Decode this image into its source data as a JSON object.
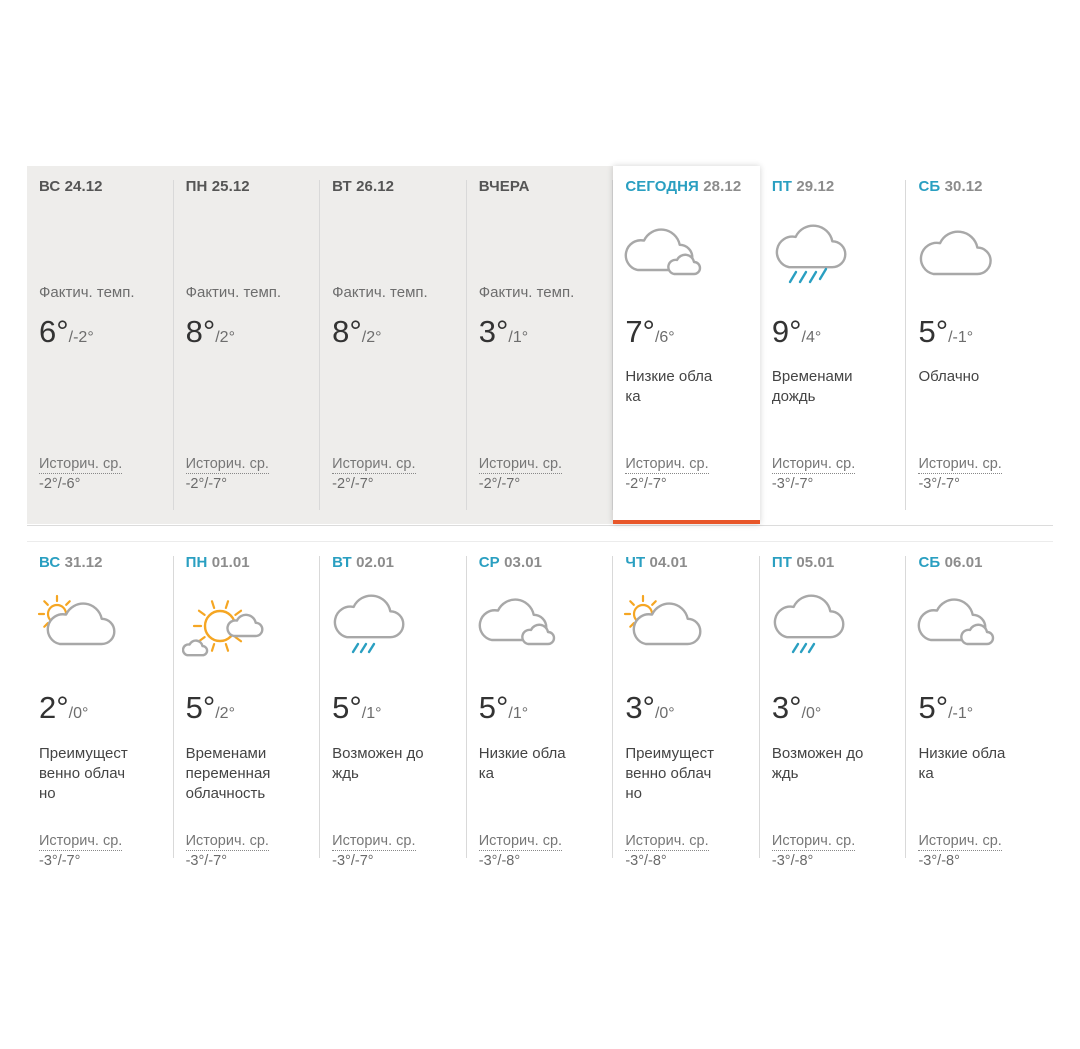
{
  "labels": {
    "fact": "Фактич. темп.",
    "hist": "Историч. ср."
  },
  "colors": {
    "accent_blue": "#2a9fc1",
    "today_bar": "#e8572a",
    "past_bg": "#eeedeb",
    "sun": "#f5a623",
    "cloud_stroke": "#a8a8a8"
  },
  "row1": [
    {
      "dow": "ВС",
      "date": "24.12",
      "hi": "6°",
      "lo": "/-2°",
      "desc": "",
      "hist": "-2°/-6°",
      "icon": "none",
      "past": true
    },
    {
      "dow": "ПН",
      "date": "25.12",
      "hi": "8°",
      "lo": "/2°",
      "desc": "",
      "hist": "-2°/-7°",
      "icon": "none",
      "past": true
    },
    {
      "dow": "ВТ",
      "date": "26.12",
      "hi": "8°",
      "lo": "/2°",
      "desc": "",
      "hist": "-2°/-7°",
      "icon": "none",
      "past": true
    },
    {
      "dow": "ВЧЕРА",
      "date": "",
      "hi": "3°",
      "lo": "/1°",
      "desc": "",
      "hist": "-2°/-7°",
      "icon": "none",
      "past": true
    },
    {
      "dow": "СЕГОДНЯ",
      "date": "28.12",
      "hi": "7°",
      "lo": "/6°",
      "desc": "Низкие обла ка",
      "desc_lines": [
        "Низкие обла",
        "ка"
      ],
      "hist": "-2°/-7°",
      "icon": "cloud-small-cloud-icon",
      "today": true
    },
    {
      "dow": "ПТ",
      "date": "29.12",
      "hi": "9°",
      "lo": "/4°",
      "desc": "Временами дождь",
      "desc_lines": [
        "Временами",
        "дождь"
      ],
      "hist": "-3°/-7°",
      "icon": "rain-cloud-icon"
    },
    {
      "dow": "СБ",
      "date": "30.12",
      "hi": "5°",
      "lo": "/-1°",
      "desc": "Облачно",
      "desc_lines": [
        "Облачно"
      ],
      "hist": "-3°/-7°",
      "icon": "cloud-icon"
    }
  ],
  "row2": [
    {
      "dow": "ВС",
      "date": "31.12",
      "hi": "2°",
      "lo": "/0°",
      "desc_lines": [
        "Преимущест",
        "венно облач",
        "но"
      ],
      "hist": "-3°/-7°",
      "icon": "partly-cloudy-icon"
    },
    {
      "dow": "ПН",
      "date": "01.01",
      "hi": "5°",
      "lo": "/2°",
      "desc_lines": [
        "Временами",
        "переменная",
        "облачность"
      ],
      "hist": "-3°/-7°",
      "icon": "sun-clouds-icon"
    },
    {
      "dow": "ВТ",
      "date": "02.01",
      "hi": "5°",
      "lo": "/1°",
      "desc_lines": [
        "Возможен до",
        "ждь"
      ],
      "hist": "-3°/-7°",
      "icon": "light-rain-cloud-icon"
    },
    {
      "dow": "СР",
      "date": "03.01",
      "hi": "5°",
      "lo": "/1°",
      "desc_lines": [
        "Низкие обла",
        "ка"
      ],
      "hist": "-3°/-8°",
      "icon": "cloud-small-cloud-icon"
    },
    {
      "dow": "ЧТ",
      "date": "04.01",
      "hi": "3°",
      "lo": "/0°",
      "desc_lines": [
        "Преимущест",
        "венно облач",
        "но"
      ],
      "hist": "-3°/-8°",
      "icon": "partly-cloudy-icon"
    },
    {
      "dow": "ПТ",
      "date": "05.01",
      "hi": "3°",
      "lo": "/0°",
      "desc_lines": [
        "Возможен до",
        "ждь"
      ],
      "hist": "-3°/-8°",
      "icon": "light-rain-cloud-icon"
    },
    {
      "dow": "СБ",
      "date": "06.01",
      "hi": "5°",
      "lo": "/-1°",
      "desc_lines": [
        "Низкие обла",
        "ка"
      ],
      "hist": "-3°/-8°",
      "icon": "cloud-small-cloud-icon"
    }
  ]
}
